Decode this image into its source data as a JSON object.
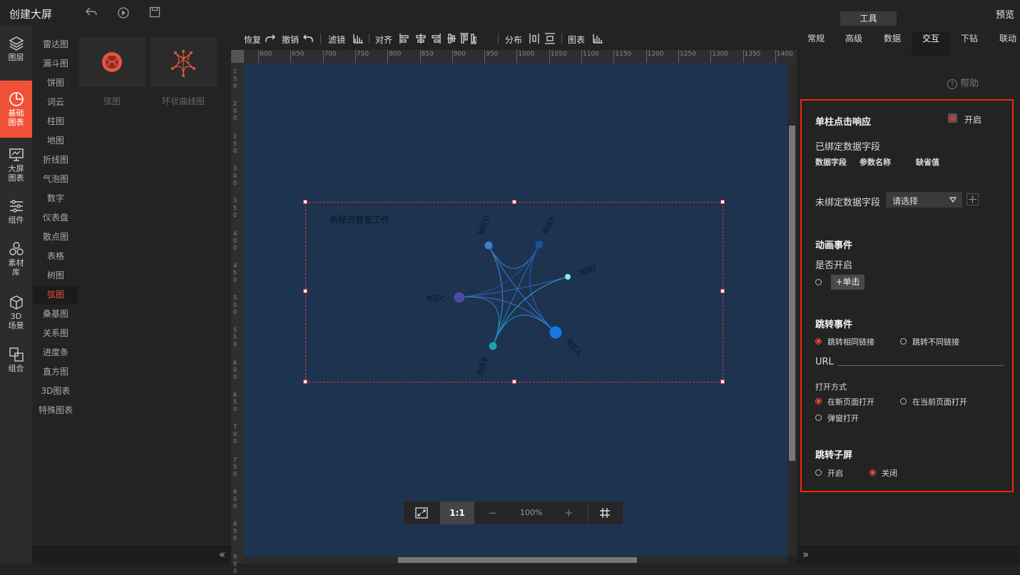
{
  "app": {
    "title": "创建大屏",
    "preview_label": "预览",
    "tool_label": "工具"
  },
  "rail": [
    {
      "name": "layers",
      "icon": "layers-icon",
      "label": "图层"
    },
    {
      "name": "basic-charts",
      "icon": "pie-chart-icon",
      "label": "基础图表"
    },
    {
      "name": "screen-charts",
      "icon": "screen-chart-icon",
      "label": "大屏图表"
    },
    {
      "name": "components",
      "icon": "sliders-icon",
      "label": "组件"
    },
    {
      "name": "materials",
      "icon": "hexagons-icon",
      "label": "素材库"
    },
    {
      "name": "3d-scene",
      "icon": "cube-icon",
      "label": "3D场景"
    },
    {
      "name": "combine",
      "icon": "combine-icon",
      "label": "组合"
    }
  ],
  "categories": [
    "雷达图",
    "漏斗图",
    "饼图",
    "词云",
    "柱图",
    "地图",
    "折线图",
    "气泡图",
    "数字",
    "仪表盘",
    "散点图",
    "表格",
    "树图",
    "弦图",
    "桑基图",
    "关系图",
    "进度条",
    "直方图",
    "3D图表",
    "特殊图表"
  ],
  "active_category": "弦图",
  "thumbnails": [
    {
      "label": "弦图"
    },
    {
      "label": "环状曲线图"
    }
  ],
  "toolbar": {
    "redo": "恢复",
    "undo": "撤销",
    "filter": "滤镜",
    "align": "对齐",
    "distribute": "分布",
    "chart": "图表"
  },
  "ruler": {
    "h_ticks": [
      "600",
      "650",
      "700",
      "750",
      "800",
      "850",
      "900",
      "950",
      "1000",
      "1050",
      "1100",
      "1150",
      "1200",
      "1250",
      "1300",
      "1350",
      "1400"
    ],
    "v_ticks": [
      "150",
      "200",
      "250",
      "300",
      "350",
      "400",
      "450",
      "500",
      "550",
      "600",
      "650",
      "700",
      "750",
      "800",
      "850",
      "900"
    ]
  },
  "widget": {
    "title": "新经济普查工作",
    "nodes": [
      {
        "label": "地区D",
        "color": "#3d7fc9"
      },
      {
        "label": "地区E",
        "color": "#1f4fa0"
      },
      {
        "label": "地区F",
        "color": "#8ee6f5"
      },
      {
        "label": "地区C",
        "color": "#4a4aa6"
      },
      {
        "label": "地区B",
        "color": "#19a3b0"
      },
      {
        "label": "地区A",
        "color": "#1a78e6"
      }
    ]
  },
  "zoom": {
    "fit_label": "fit-screen-icon",
    "ratio_label": "1:1",
    "minus": "−",
    "value": "100%",
    "plus": "+",
    "grid_icon": "grid-icon"
  },
  "panel": {
    "tabs": [
      "常规",
      "高级",
      "数据",
      "交互",
      "下钻",
      "联动"
    ],
    "active_tab": "交互",
    "help": "帮助",
    "single_click": {
      "title": "单柱点击响应",
      "enable_label": "开启"
    },
    "bound_fields": {
      "title": "已绑定数据字段",
      "cols": [
        "数据字段",
        "参数名称",
        "缺省值"
      ]
    },
    "unbound": {
      "label": "未绑定数据字段",
      "select_placeholder": "请选择"
    },
    "animation": {
      "title": "动画事件",
      "enable_q": "是否开启",
      "add_click": "+单击"
    },
    "jump": {
      "title": "跳转事件",
      "options": [
        "跳转相同链接",
        "跳转不同链接"
      ],
      "url_label": "URL",
      "open_mode": "打开方式",
      "open_options": [
        "在新页面打开",
        "在当前页面打开",
        "弹窗打开"
      ]
    },
    "sub_screen": {
      "title": "跳转子屏",
      "options": [
        "开启",
        "关闭"
      ]
    }
  },
  "colors": {
    "accent": "#f05136",
    "canvas": "#1d334f",
    "highlight_box": "#f0270d"
  }
}
